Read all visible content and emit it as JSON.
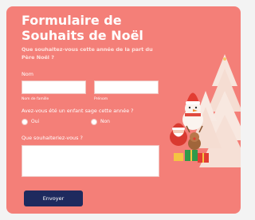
{
  "form": {
    "title": "Formulaire de Souhaits de Noël",
    "subtitle": "Que souhaitez-vous cette année de la part du Père Noël ?",
    "name_label": "Nom",
    "first_name_sublabel": "Nom de famille",
    "last_name_sublabel": "Prénom",
    "first_name_value": "",
    "last_name_value": "",
    "question_label": "Avez-vous été un enfant sage cette année ?",
    "radio_yes": "Oui",
    "radio_no": "Non",
    "wish_label": "Que souhaiteriez-vous ?",
    "wish_value": "",
    "submit_label": "Envoyer"
  },
  "colors": {
    "background": "#f47f78",
    "button": "#1e2a5e",
    "text": "#ffffff"
  },
  "icons": [
    "christmas-trees-illustration",
    "snowman-icon",
    "santa-claus-icon",
    "reindeer-icon",
    "gift-box-icon"
  ]
}
